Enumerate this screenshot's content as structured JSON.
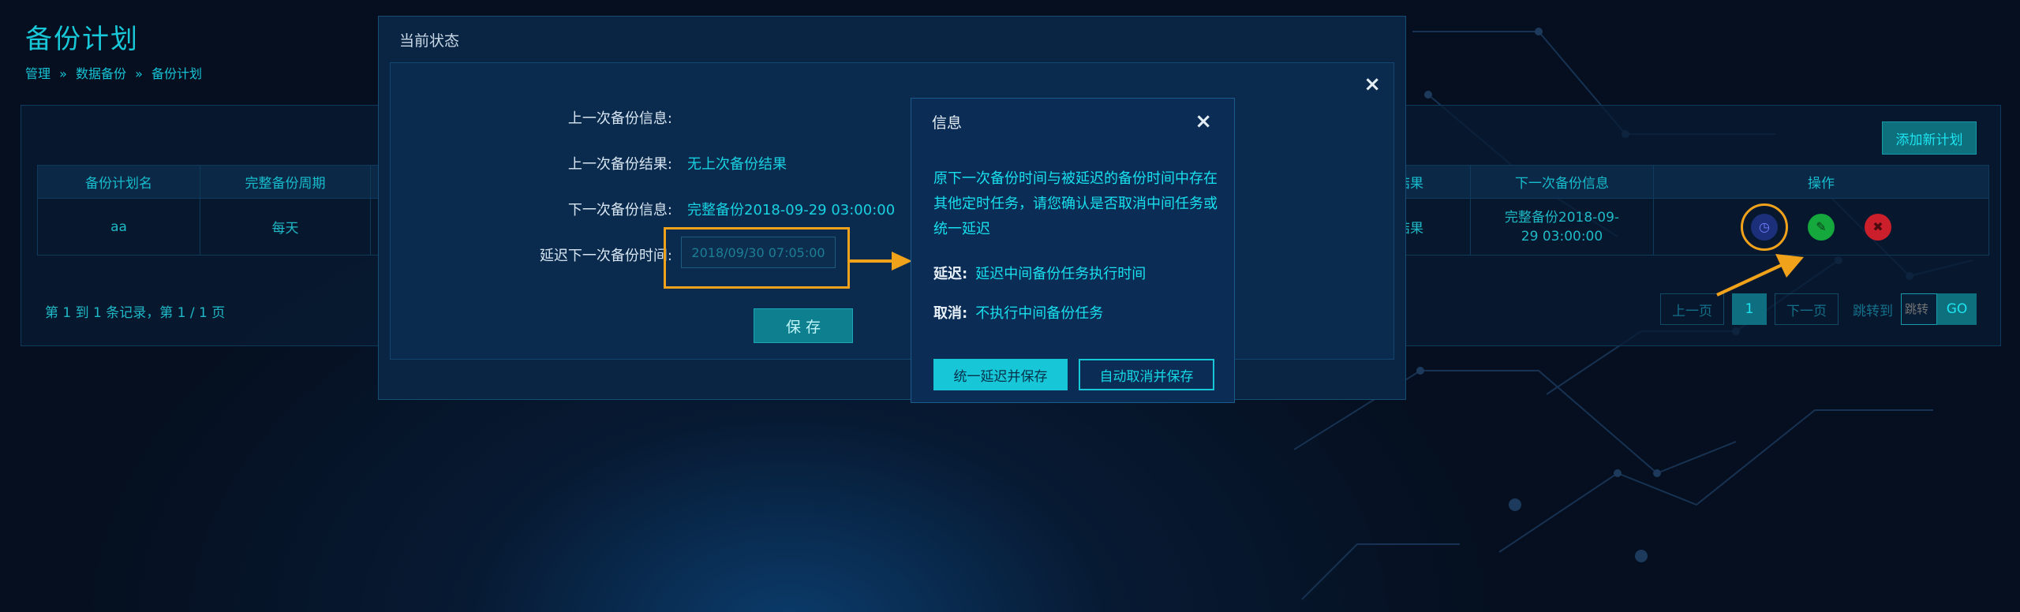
{
  "page": {
    "title": "备份计划",
    "breadcrumb": [
      "管理",
      "»",
      "数据备份",
      "»",
      "备份计划"
    ]
  },
  "main": {
    "add_button": "添加新计划",
    "columns": [
      "备份计划名",
      "完整备份周期",
      "",
      "",
      "",
      "",
      "",
      "次备份结果",
      "下一次备份信息",
      "操作"
    ],
    "rows": [
      {
        "name": "aa",
        "cycle": "每天",
        "last_result": "次备份结果",
        "next_info": "完整备份2018-09-29 03:00:00"
      }
    ],
    "record_info": "第 1 到 1 条记录，第 1 / 1 页",
    "pager": {
      "prev": "上一页",
      "current": "1",
      "next": "下一页",
      "jump_label": "跳转到",
      "jump_placeholder": "跳转",
      "go": "GO"
    }
  },
  "status_modal": {
    "title": "当前状态",
    "close": "×",
    "last_info_label": "上一次备份信息:",
    "last_info_value": "",
    "last_result_label": "上一次备份结果:",
    "last_result_value": "无上次备份结果",
    "next_info_label": "下一次备份信息:",
    "next_info_value": "完整备份2018-09-29 03:00:00",
    "delay_label": "延迟下一次备份时间:",
    "delay_value": "2018/09/30 07:05:00",
    "save": "保 存"
  },
  "info_dialog": {
    "title": "信息",
    "close": "×",
    "message": "原下一次备份时间与被延迟的备份时间中存在其他定时任务，请您确认是否取消中间任务或统一延迟",
    "delay_key": "延迟:",
    "delay_text": "延迟中间备份任务执行时间",
    "cancel_key": "取消:",
    "cancel_text": "不执行中间备份任务",
    "btn_unify": "统一延迟并保存",
    "btn_auto_cancel": "自动取消并保存"
  },
  "icons": {
    "delay": "clock-icon",
    "edit": "pencil-icon",
    "delete": "trash-icon"
  },
  "colors": {
    "accent": "#19d1e0",
    "highlight": "#f0a21b",
    "edit": "#14a83d",
    "delete": "#cc1f2c"
  }
}
